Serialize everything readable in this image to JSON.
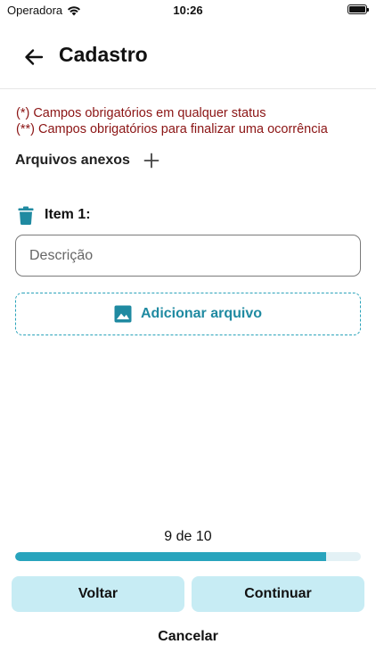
{
  "status_bar": {
    "carrier": "Operadora",
    "time": "10:26"
  },
  "header": {
    "title": "Cadastro"
  },
  "notes": {
    "required_any": "(*) Campos obrigatórios em qualquer status",
    "required_finish": "(**) Campos obrigatórios para finalizar uma ocorrência"
  },
  "attachments": {
    "label": "Arquivos anexos",
    "items": [
      {
        "title": "Item 1:",
        "description_placeholder": "Descrição",
        "description_value": "",
        "add_file_label": "Adicionar arquivo"
      }
    ]
  },
  "progress": {
    "text": "9 de 10",
    "current": 9,
    "total": 10
  },
  "footer": {
    "back_label": "Voltar",
    "continue_label": "Continuar",
    "cancel_label": "Cancelar"
  },
  "icons": {
    "back": "arrow-left-icon",
    "add": "plus-icon",
    "delete": "trash-icon",
    "image": "image-icon",
    "wifi": "wifi-icon",
    "battery": "battery-icon"
  },
  "colors": {
    "accent": "#28a4bd",
    "accent_text": "#1f8aa1",
    "button_bg": "#c7ecf4",
    "notes": "#8b1414",
    "track": "#e3f1f5"
  }
}
